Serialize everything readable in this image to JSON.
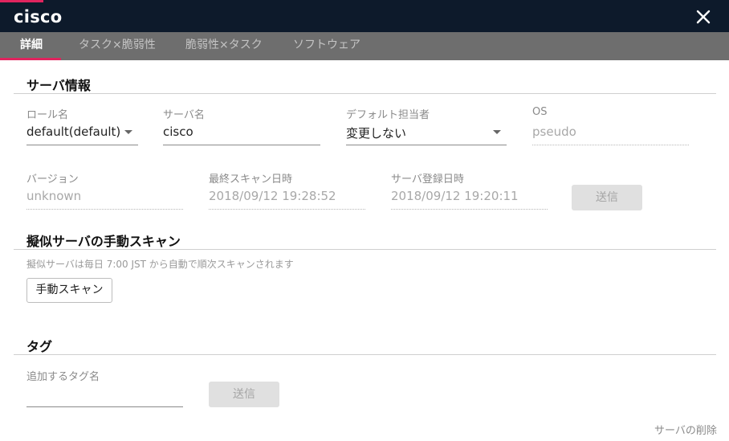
{
  "window": {
    "title": "cisco",
    "close_icon": "close-icon"
  },
  "tabs": [
    {
      "label": "詳細",
      "active": true
    },
    {
      "label": "タスク×脆弱性",
      "active": false
    },
    {
      "label": "脆弱性×タスク",
      "active": false
    },
    {
      "label": "ソフトウェア",
      "active": false
    }
  ],
  "server_info": {
    "title": "サーバ情報",
    "role": {
      "label": "ロール名",
      "value": "default(default)"
    },
    "server_name": {
      "label": "サーバ名",
      "value": "cisco"
    },
    "default_assignee": {
      "label": "デフォルト担当者",
      "value": "変更しない"
    },
    "os": {
      "label": "OS",
      "value": "pseudo"
    },
    "version": {
      "label": "バージョン",
      "value": "unknown"
    },
    "last_scan": {
      "label": "最終スキャン日時",
      "value": "2018/09/12 19:28:52"
    },
    "registered": {
      "label": "サーバ登録日時",
      "value": "2018/09/12 19:20:11"
    },
    "submit_label": "送信"
  },
  "manual_scan": {
    "title": "擬似サーバの手動スキャン",
    "hint": "擬似サーバは毎日 7:00 JST から自動で順次スキャンされます",
    "button_label": "手動スキャン"
  },
  "tags": {
    "title": "タグ",
    "input_label": "追加するタグ名",
    "input_value": "",
    "submit_label": "送信"
  },
  "delete_link": "サーバの削除",
  "colors": {
    "titlebar": "#0d1a2b",
    "tabbar": "#6e6e6e",
    "accent": "#e0245e"
  }
}
